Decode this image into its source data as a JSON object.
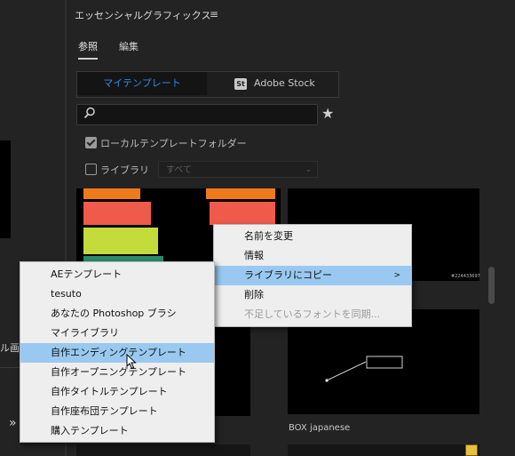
{
  "timeline": {
    "left_label": "ル画",
    "arrows": "»"
  },
  "panel": {
    "title": "エッセンシャルグラフィックス",
    "menu_icon": "≡",
    "tabs": [
      {
        "label": "参照",
        "active": true
      },
      {
        "label": "編集",
        "active": false
      }
    ],
    "segment": {
      "my_templates": "マイテンプレート",
      "adobe_stock": "Adobe Stock",
      "stock_badge": "St"
    },
    "search": {
      "value": "",
      "placeholder": ""
    },
    "star_icon": "★",
    "local_folder": {
      "label": "ローカルテンプレートフォルダー",
      "checked": true
    },
    "library": {
      "label": "ライブラリ",
      "checked": false,
      "select_value": "すべて",
      "select_arrow": "⌄"
    }
  },
  "grid": {
    "stock_id": "#224433697",
    "box_label": "BOX japanese",
    "scroll_arrow": "ˇ"
  },
  "context_menu": {
    "items": [
      {
        "label": "名前を変更",
        "state": "normal"
      },
      {
        "label": "情報",
        "state": "normal"
      },
      {
        "label": "ライブラリにコピー",
        "state": "highlighted",
        "submenu_arrow": ">"
      },
      {
        "label": "削除",
        "state": "normal"
      },
      {
        "label": "不足しているフォントを同期...",
        "state": "disabled"
      }
    ]
  },
  "library_submenu": {
    "items": [
      {
        "label": "AEテンプレート"
      },
      {
        "label": "tesuto"
      },
      {
        "label": "あなたの Photoshop ブラシ"
      },
      {
        "label": "マイライブラリ"
      },
      {
        "label": "自作エンディングテンプレート",
        "highlighted": true
      },
      {
        "label": "自作オープニングテンプレート"
      },
      {
        "label": "自作タイトルテンプレート"
      },
      {
        "label": "自作座布団テンプレート"
      },
      {
        "label": "購入テンプレート"
      }
    ]
  },
  "colors": {
    "accent": "#2d8ceb",
    "menu_bg": "#eeeeee",
    "menu_highlight": "#99c9f0",
    "bar_orange": "#f07a1a",
    "bar_red": "#f05a4a",
    "bar_lime": "#c3dc3c",
    "bar_teal": "#2a8a6a"
  }
}
